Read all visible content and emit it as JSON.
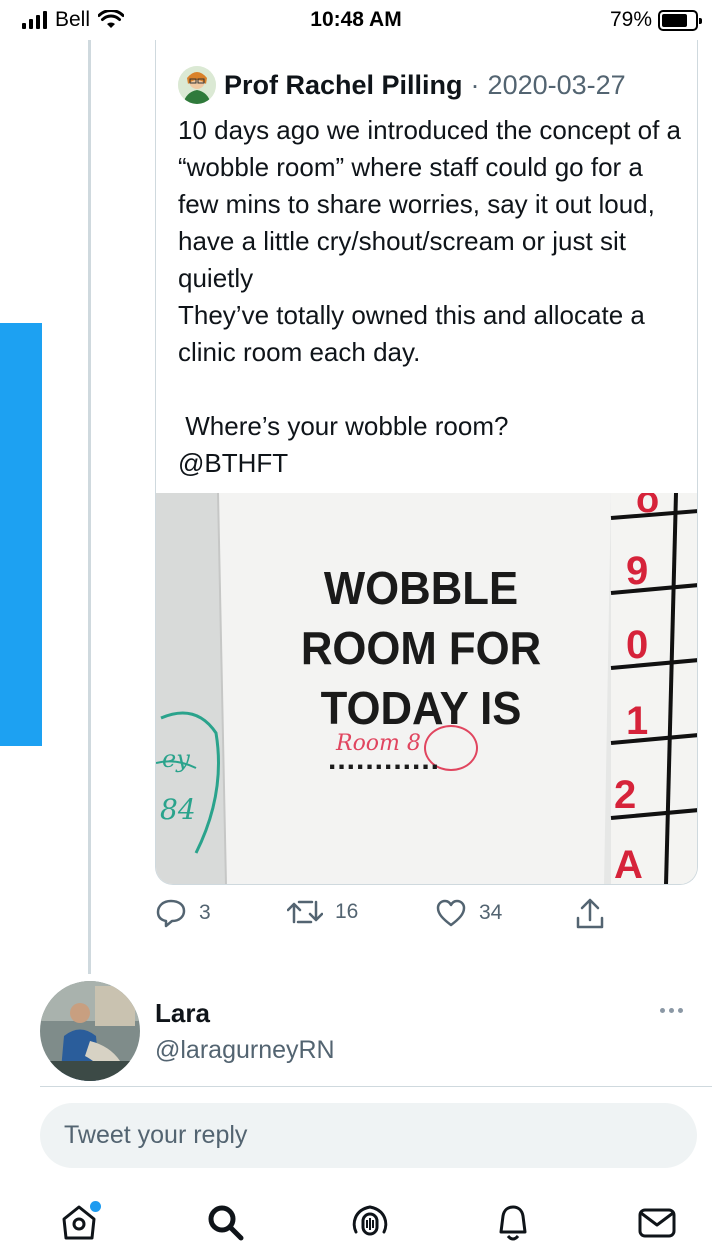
{
  "status_bar": {
    "carrier": "Bell",
    "time": "10:48 AM",
    "battery_percent": "79%",
    "battery_level": 0.79
  },
  "quoted_tweet": {
    "author_name": "Prof Rachel Pilling",
    "separator": "·",
    "date": "2020-03-27",
    "text": "10 days ago we introduced the concept of a “wobble room” where staff could go for a few mins to share worries, say it out loud, have a little cry/shout/scream or just sit quietly\nThey’ve totally owned this and allocate a clinic room each day.\n\n Where’s your wobble room?\n@BTHFT",
    "image": {
      "sign_line1": "WOBBLE",
      "sign_line2": "ROOM FOR",
      "sign_line3": "TODAY IS",
      "handwritten": "Room 8",
      "dots": "............",
      "board_numbers": [
        "9",
        "0",
        "1",
        "2",
        "A"
      ],
      "board_top": "o",
      "marker_text": "ey",
      "marker_number": "84"
    }
  },
  "actions": {
    "reply_count": "3",
    "retweet_count": "16",
    "like_count": "34"
  },
  "composer": {
    "user_name": "Lara",
    "user_handle": "@laragurneyRN",
    "reply_placeholder": "Tweet your reply"
  },
  "tabbar": {
    "items": [
      "home-icon",
      "search-icon",
      "spaces-icon",
      "notifications-icon",
      "messages-icon"
    ]
  },
  "colors": {
    "accent": "#1da1f2",
    "text": "#0f1419",
    "secondary": "#536471",
    "border": "#cfd9de"
  }
}
